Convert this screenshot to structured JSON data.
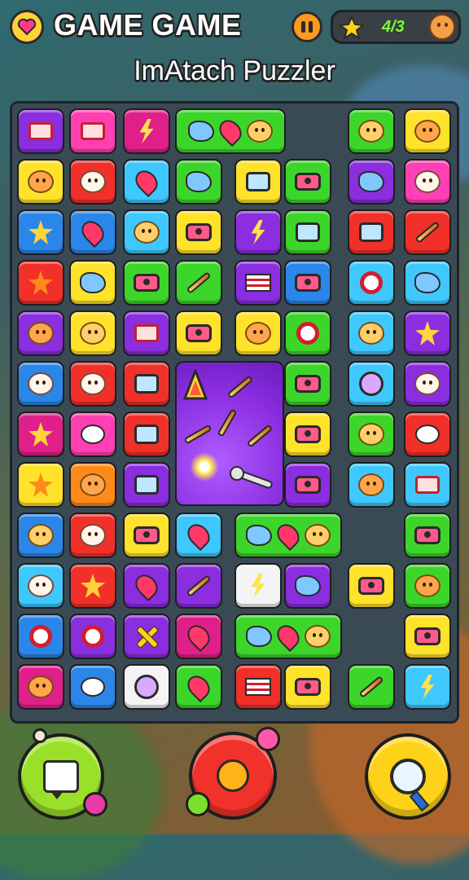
{
  "header": {
    "title": "GAME GAME",
    "subtitle": "ImAtach Puzzler",
    "score": "4/3"
  },
  "colors": {
    "purple": "#8a2ee0",
    "pink": "#ff3fb4",
    "magenta": "#e0208a",
    "lime": "#3cd62a",
    "yellow": "#ffe22a",
    "red": "#f2302a",
    "blue": "#2a86e8",
    "cyan": "#3ec8ff",
    "orange": "#ff8a1a",
    "white": "#f4f4f4",
    "crimson": "#c81e2e"
  },
  "board": {
    "columns": 8,
    "rows": 12,
    "special_tile": "combo-bomb"
  },
  "controls": {
    "left": "chat-icon",
    "middle": "key-icon",
    "right": "magnifier-icon"
  }
}
